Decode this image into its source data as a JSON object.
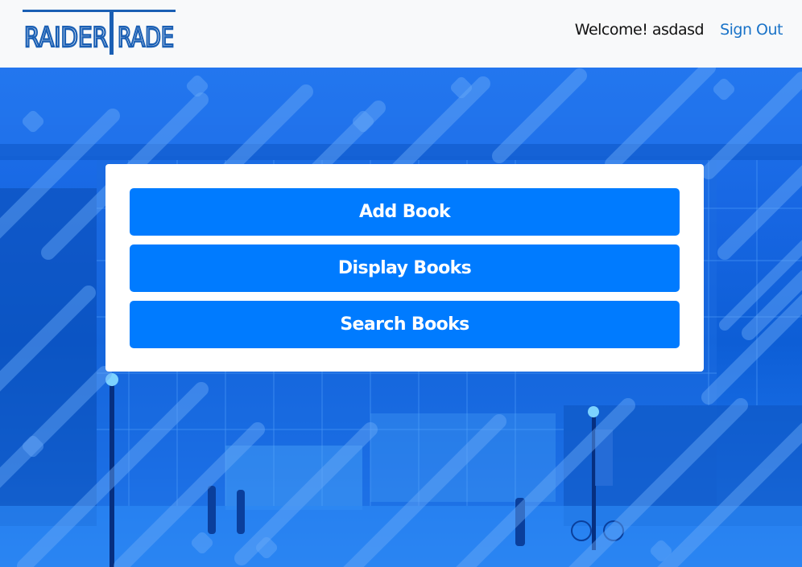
{
  "header": {
    "logo_text": "RAIDERTRADE",
    "welcome_text": "Welcome! asdasd",
    "signout_label": "Sign Out"
  },
  "actions": {
    "add_label": "Add Book",
    "display_label": "Display Books",
    "search_label": "Search Books"
  },
  "colors": {
    "primary": "#007bff",
    "navbar_bg": "#f8f9fa",
    "logo": "#1a5fb4",
    "hero_overlay": "#1766e2"
  }
}
